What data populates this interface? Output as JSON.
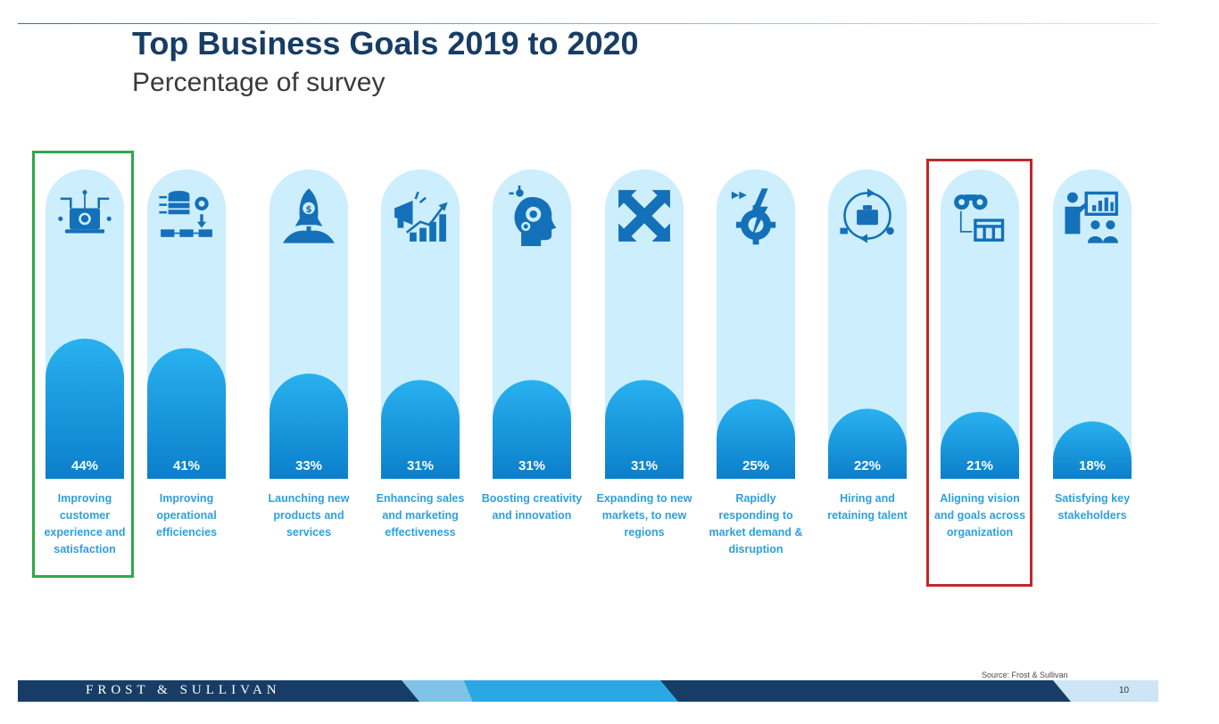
{
  "header": {
    "title": "Top Business Goals 2019 to 2020",
    "subtitle": "Percentage of survey"
  },
  "chart_data": {
    "type": "bar",
    "title": "Top Business Goals 2019 to 2020",
    "subtitle": "Percentage of survey",
    "categories": [
      "Improving customer experience and satisfaction",
      "Improving operational efficiencies",
      "Launching new products and services",
      "Enhancing sales and marketing effectiveness",
      "Boosting creativity and innovation",
      "Expanding to new markets, to new regions",
      "Rapidly responding to market demand & disruption",
      "Hiring and retaining talent",
      "Aligning vision and goals across organization",
      "Satisfying key stakeholders"
    ],
    "value_labels": [
      "44%",
      "41%",
      "33%",
      "31%",
      "31%",
      "31%",
      "25%",
      "22%",
      "21%",
      "18%"
    ],
    "values": [
      44,
      41,
      33,
      31,
      31,
      31,
      25,
      22,
      21,
      18
    ],
    "ylim": [
      0,
      100
    ],
    "icons": [
      "laptop-network-icon",
      "database-process-icon",
      "rocket-launch-icon",
      "megaphone-growth-icon",
      "head-gears-icon",
      "expand-arrows-icon",
      "lightning-gear-icon",
      "briefcase-cycle-icon",
      "binoculars-chart-icon",
      "presenter-audience-icon"
    ],
    "highlights": [
      {
        "index": 0,
        "color": "#2fa84a"
      },
      {
        "index": 8,
        "color": "#c0282a"
      }
    ],
    "colors": {
      "track": "#cdeefc",
      "bar_top": "#29b1ef",
      "bar_bottom": "#0b7fcb",
      "icon": "#1470b8",
      "label": "#2f9fe0"
    }
  },
  "footer": {
    "brand": "FROST & SULLIVAN",
    "source": "Source: Frost & Sullivan",
    "page": "10"
  }
}
